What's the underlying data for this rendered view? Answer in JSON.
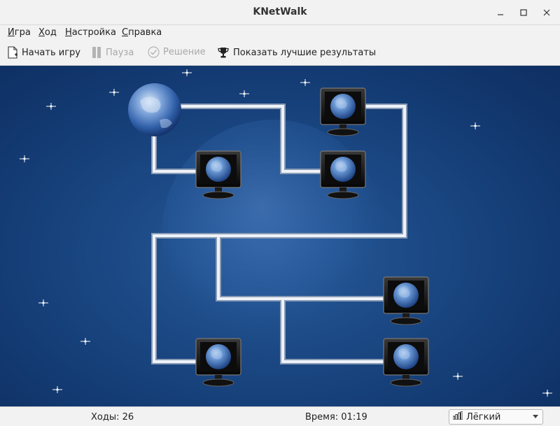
{
  "window": {
    "title": "KNetWalk"
  },
  "menu": [
    {
      "label": "Игра",
      "underline": "И",
      "rest": "гра"
    },
    {
      "label": "Ход",
      "underline": "Х",
      "rest": "од"
    },
    {
      "label": "Настройка",
      "underline": "Н",
      "rest": "астройка"
    },
    {
      "label": "Справка",
      "underline": "С",
      "rest": "правка"
    }
  ],
  "toolbar": {
    "new_game": "Начать игру",
    "pause": "Пауза",
    "solve": "Решение",
    "highscores": "Показать лучшие результаты"
  },
  "status": {
    "moves": "Ходы: 26",
    "time": "Время: 01:19",
    "difficulty": "Лёгкий"
  },
  "board": {
    "server": {
      "col": 0,
      "row": 0
    },
    "computers": [
      {
        "col": 1,
        "row": 1
      },
      {
        "col": 3,
        "row": 0
      },
      {
        "col": 3,
        "row": 1
      },
      {
        "col": 4,
        "row": 3
      },
      {
        "col": 1,
        "row": 4
      },
      {
        "col": 4,
        "row": 4
      }
    ]
  },
  "colors": {
    "board_bg": "#133a72",
    "cable": "#e8eef6",
    "accent": "#3a6fb0"
  }
}
